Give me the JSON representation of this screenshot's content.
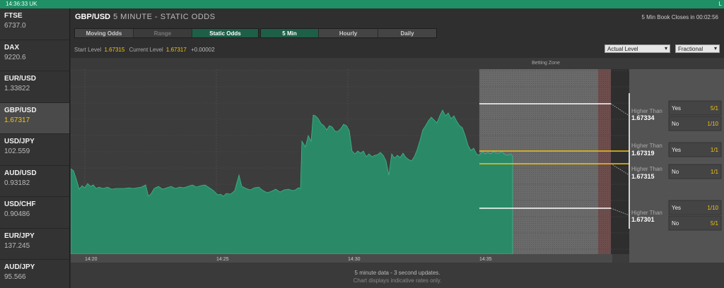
{
  "topbar": {
    "time": "14:36:33 UK",
    "flag": "L"
  },
  "markets": [
    {
      "name": "FTSE",
      "price": "6737.0",
      "active": false
    },
    {
      "name": "DAX",
      "price": "9220.6",
      "active": false
    },
    {
      "name": "EUR/USD",
      "price": "1.33822",
      "active": false
    },
    {
      "name": "GBP/USD",
      "price": "1.67317",
      "active": true
    },
    {
      "name": "USD/JPY",
      "price": "102.559",
      "active": false
    },
    {
      "name": "AUD/USD",
      "price": "0.93182",
      "active": false
    },
    {
      "name": "USD/CHF",
      "price": "0.90486",
      "active": false
    },
    {
      "name": "EUR/JPY",
      "price": "137.245",
      "active": false
    },
    {
      "name": "AUD/JPY",
      "price": "95.566",
      "active": false
    }
  ],
  "header": {
    "pair": "GBP/USD",
    "mode": "5 MINUTE - STATIC ODDS",
    "closes": "5 Min Book Closes in 00:02:56"
  },
  "mode_tabs": {
    "moving": "Moving Odds",
    "range": "Range",
    "static": "Static Odds"
  },
  "period_tabs": {
    "five_min": "5 Min",
    "hourly": "Hourly",
    "daily": "Daily"
  },
  "levels": {
    "start_label": "Start Level",
    "start_value": "1.67315",
    "current_label": "Current Level",
    "current_value": "1.67317",
    "change": "+0.00002"
  },
  "selects": {
    "level": "Actual Level",
    "odds_format": "Fractional"
  },
  "chart": {
    "betting_zone_label": "Betting Zone",
    "time_labels": [
      "14:20",
      "14:25",
      "14:30",
      "14:35"
    ],
    "footer_line1": "5 minute data - 3 second updates.",
    "footer_line2": "Chart displays indicative rates only."
  },
  "odds": [
    {
      "label": "Higher Than",
      "level": "1.67334",
      "options": [
        {
          "side": "Yes",
          "price": "5/1"
        },
        {
          "side": "No",
          "price": "1/10"
        }
      ]
    },
    {
      "label": "Higher Than",
      "level": "1.67319",
      "options": [
        {
          "side": "Yes",
          "price": "1/1"
        }
      ]
    },
    {
      "label": "Higher Than",
      "level": "1.67315",
      "options": [
        {
          "side": "No",
          "price": "1/1"
        }
      ]
    },
    {
      "label": "Higher Than",
      "level": "1.67301",
      "options": [
        {
          "side": "Yes",
          "price": "1/10"
        },
        {
          "side": "No",
          "price": "5/1"
        }
      ]
    }
  ],
  "colors": {
    "accent": "#1f8f66",
    "area": "#2a8a68",
    "highlight": "#f2c510"
  }
}
